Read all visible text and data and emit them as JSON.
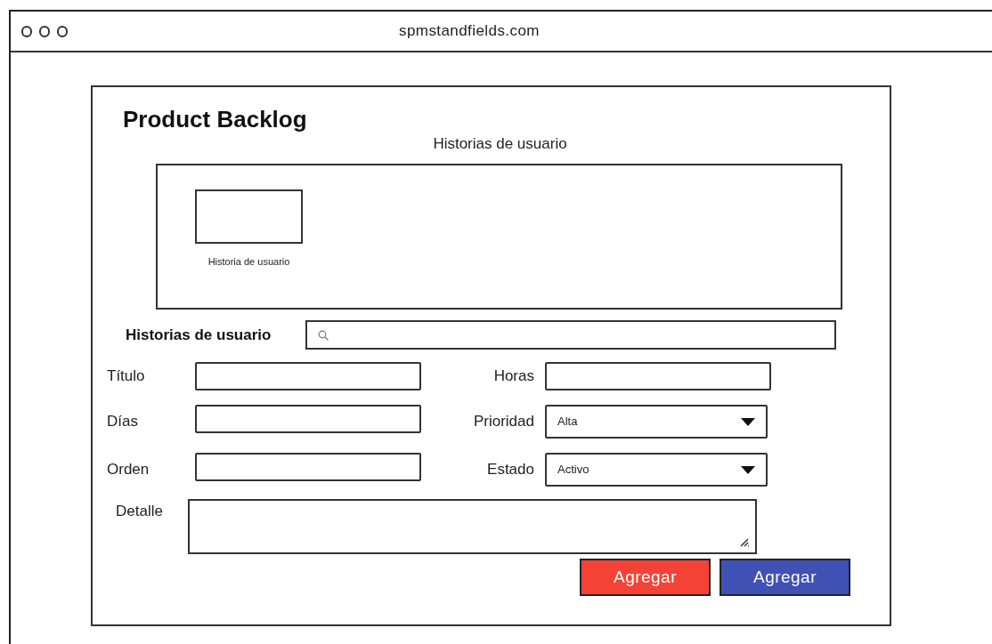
{
  "browser": {
    "url": "spmstandfields.com"
  },
  "page": {
    "title": "Product Backlog",
    "subtitle": "Historias de usuario"
  },
  "story_cards": [
    {
      "caption": "Historia de usuario"
    }
  ],
  "search": {
    "label": "Historias de usuario"
  },
  "form": {
    "left": [
      {
        "label": "Título",
        "kind": "text"
      },
      {
        "label": "Días",
        "kind": "text"
      },
      {
        "label": "Orden",
        "kind": "text"
      }
    ],
    "right": [
      {
        "label": "Horas",
        "kind": "text"
      },
      {
        "label": "Prioridad",
        "kind": "select",
        "value": "Alta"
      },
      {
        "label": "Estado",
        "kind": "select",
        "value": "Activo"
      }
    ],
    "detail": {
      "label": "Detalle"
    }
  },
  "buttons": [
    {
      "label": "Agregar",
      "color": "#f44336"
    },
    {
      "label": "Agregar",
      "color": "#3f51b5"
    }
  ]
}
